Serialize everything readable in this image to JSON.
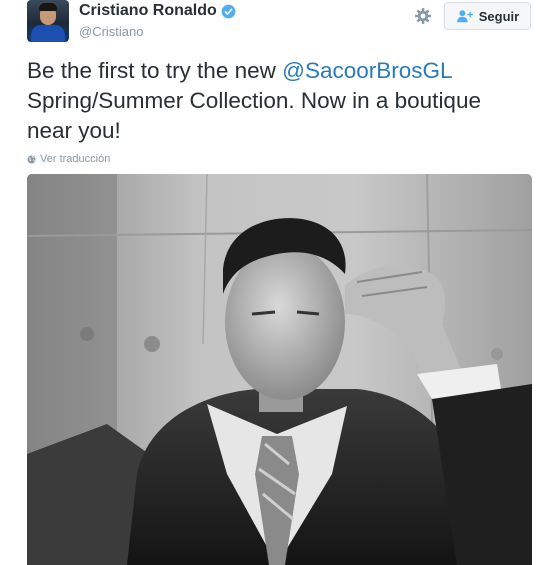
{
  "user": {
    "name": "Cristiano Ronaldo",
    "handle": "@Cristiano",
    "verified": true
  },
  "actions": {
    "follow_label": "Seguir"
  },
  "tweet": {
    "text_before": "Be the first to try the new ",
    "mention": "@SacoorBrosGL",
    "text_after": " Spring/Summer Collection. Now in a boutique near you!",
    "translate_label": "Ver traducción"
  },
  "icons": {
    "verified": "verified-badge-icon",
    "gear": "gear-icon",
    "follow": "person-plus-icon",
    "translate": "globe-icon"
  },
  "colors": {
    "link": "#2b7bb9",
    "verified": "#55acee",
    "text": "#292f33",
    "muted": "#8899a6"
  }
}
